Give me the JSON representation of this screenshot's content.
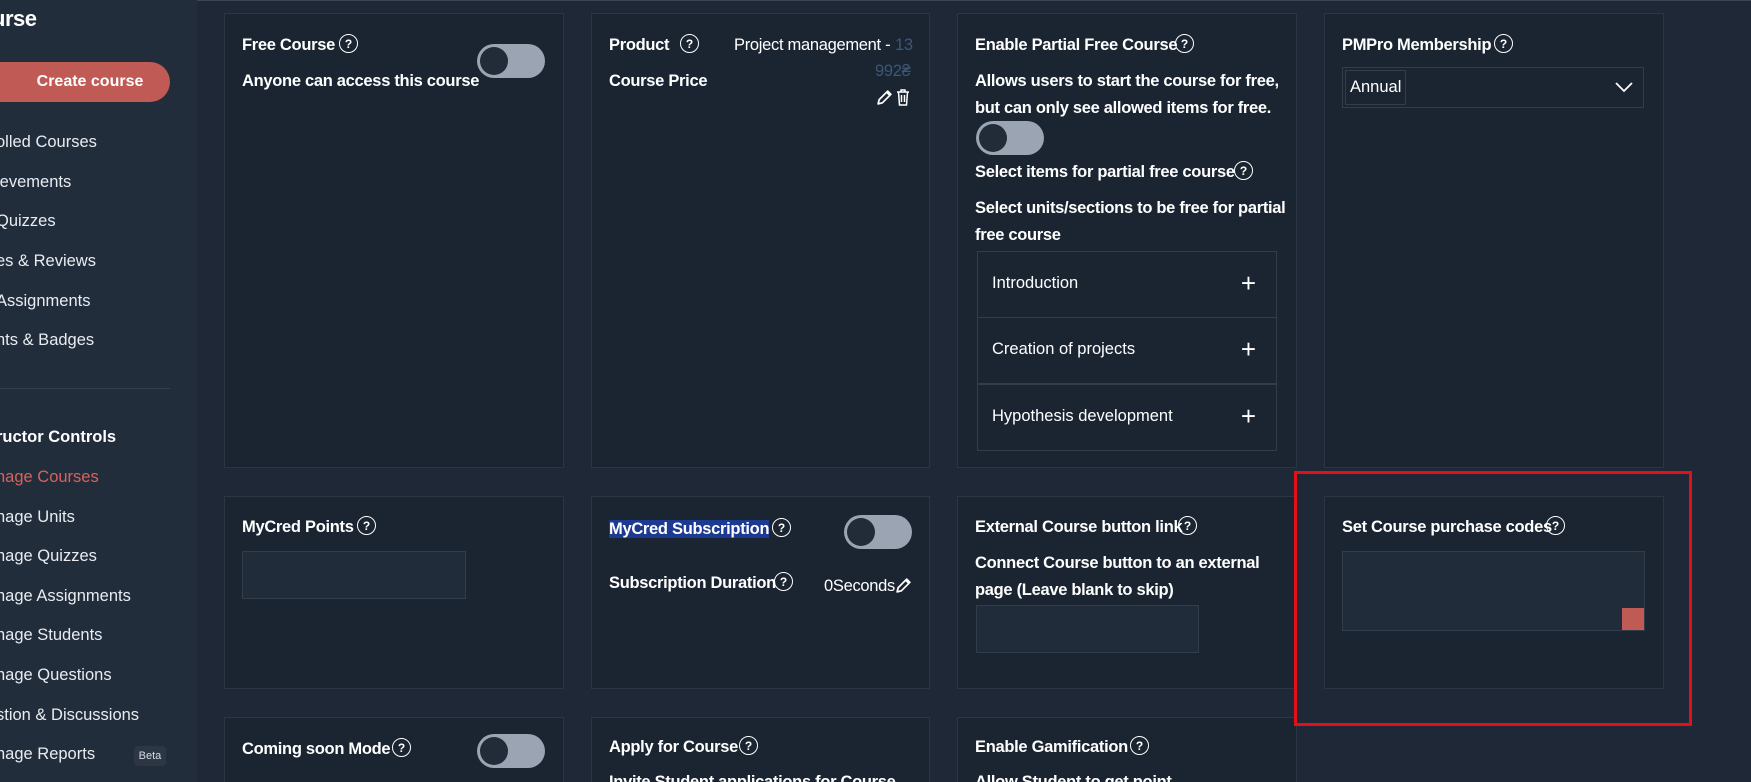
{
  "sidebar": {
    "title": "urse",
    "create_label": "Create course",
    "items": [
      "olled Courses",
      "ievements",
      "Quizzes",
      "es & Reviews",
      "Assignments",
      "nts & Badges"
    ],
    "section_heading": "ructor Controls",
    "controls": [
      "nage Courses",
      "nage Units",
      "nage Quizzes",
      "nage Assignments",
      "nage Students",
      "nage Questions",
      "stion & Discussions",
      "nage Reports"
    ],
    "active_control": "nage Courses",
    "beta_badge": "Beta"
  },
  "cards": {
    "free_course": {
      "label": "Free Course",
      "description": "Anyone can access this course",
      "toggle_on": false
    },
    "product": {
      "label": "Product",
      "value": "Project management -",
      "price_label": "Course Price",
      "price_part1": "13",
      "price_part2": "992₴"
    },
    "partial_free": {
      "label": "Enable Partial Free Course",
      "description_line1": "Allows users to start the course for free,",
      "description_line2": "but can only see allowed items for free.",
      "toggle_on": false,
      "items_label": "Select items for partial free course",
      "units_line1": "Select units/sections to be free for partial",
      "units_line2": "free course",
      "units": [
        "Introduction",
        "Creation of projects",
        "Hypothesis development"
      ]
    },
    "pmpro": {
      "label": "PMPro Membership",
      "selected": "Annual"
    },
    "mycred_points": {
      "label": "MyCred Points",
      "value": ""
    },
    "mycred_subscription": {
      "label": "MyCred Subscription",
      "toggle_on": false,
      "duration_label": "Subscription Duration",
      "duration_value": "0Seconds"
    },
    "external_link": {
      "label": "External Course button link",
      "description_line1": "Connect Course button to an external",
      "description_line2": "page (Leave blank to skip)",
      "value": ""
    },
    "purchase_codes": {
      "label": "Set Course purchase codes",
      "value": ""
    },
    "coming_soon": {
      "label": "Coming soon Mode",
      "toggle_on": false
    },
    "apply_course": {
      "label": "Apply for Course",
      "description": "Invite Student applications for Course"
    },
    "gamification": {
      "label": "Enable Gamification",
      "description": "Allow Student to get point"
    }
  },
  "colors": {
    "accent": "#c05a55",
    "active_nav": "#d8625d",
    "highlight_box": "#e60f18"
  }
}
